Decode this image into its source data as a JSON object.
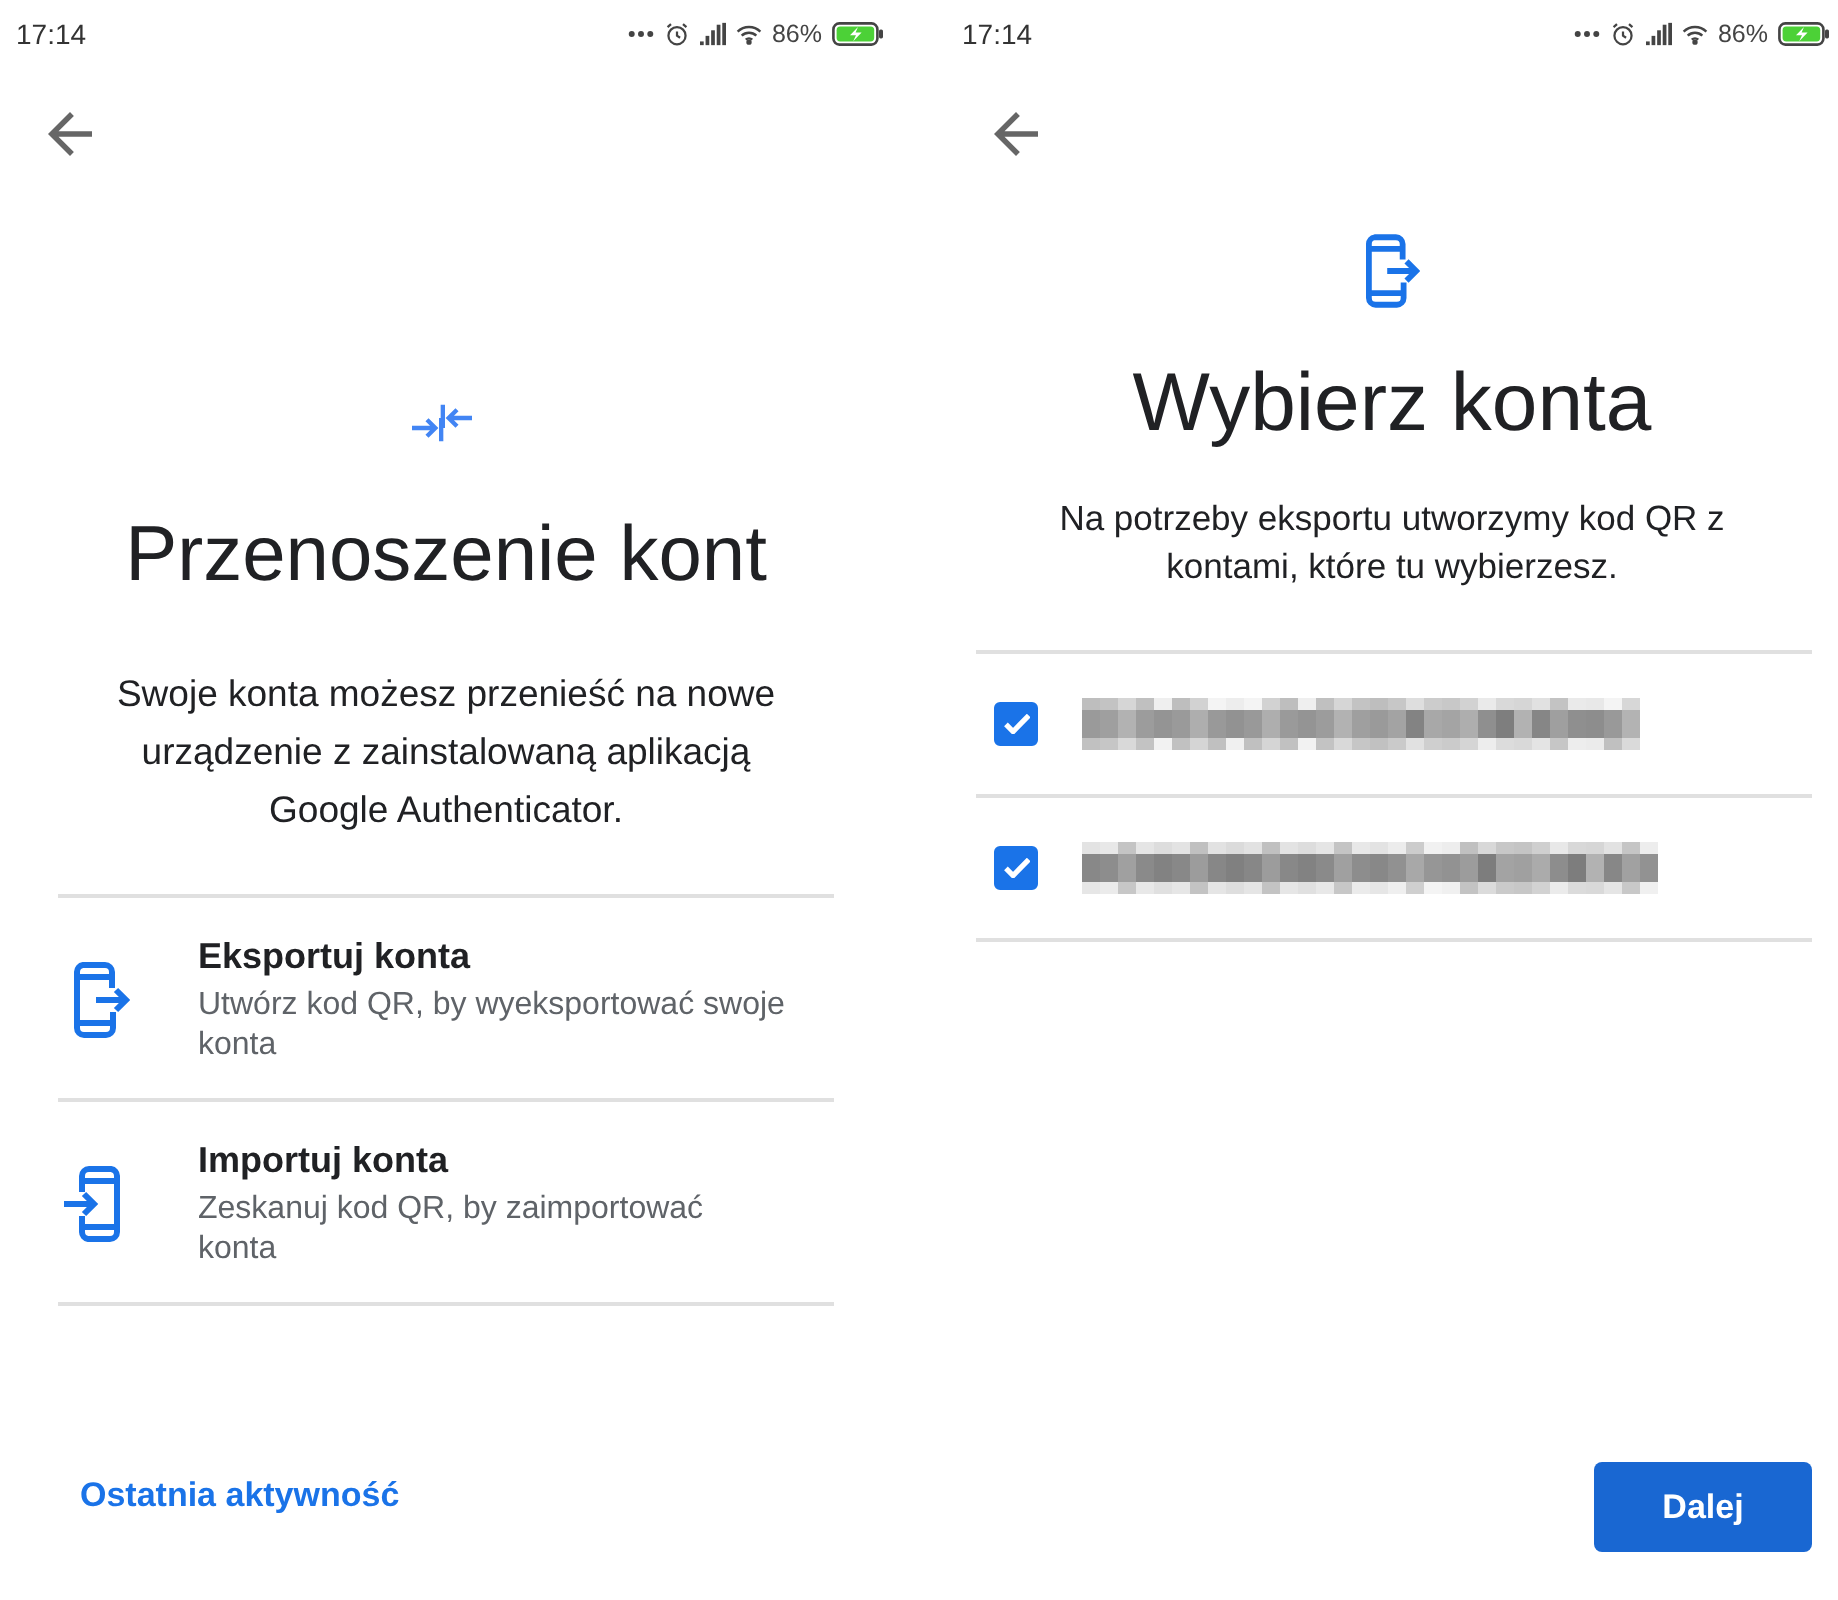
{
  "transfer_screen": {
    "status_bar": {
      "time": "17:14",
      "battery": "86%"
    },
    "title": "Przenoszenie kont",
    "description": "Swoje konta możesz przenieść na nowe urządzenie z zainstalowaną aplikacją Google Authenticator.",
    "options": [
      {
        "kind": "export",
        "title": "Eksportuj konta",
        "subtitle": "Utwórz kod QR, by wyeksportować swoje konta"
      },
      {
        "kind": "import",
        "title": "Importuj konta",
        "subtitle": "Zeskanuj kod QR, by zaimportować konta"
      }
    ],
    "footer_link": "Ostatnia aktywność"
  },
  "select_screen": {
    "status_bar": {
      "time": "17:14",
      "battery": "86%"
    },
    "title": "Wybierz konta",
    "description": "Na potrzeby eksportu utworzymy kod QR z kontami, które tu wybierzesz.",
    "accounts": [
      {
        "checked": true
      },
      {
        "checked": true
      }
    ],
    "next_button": "Dalej"
  }
}
